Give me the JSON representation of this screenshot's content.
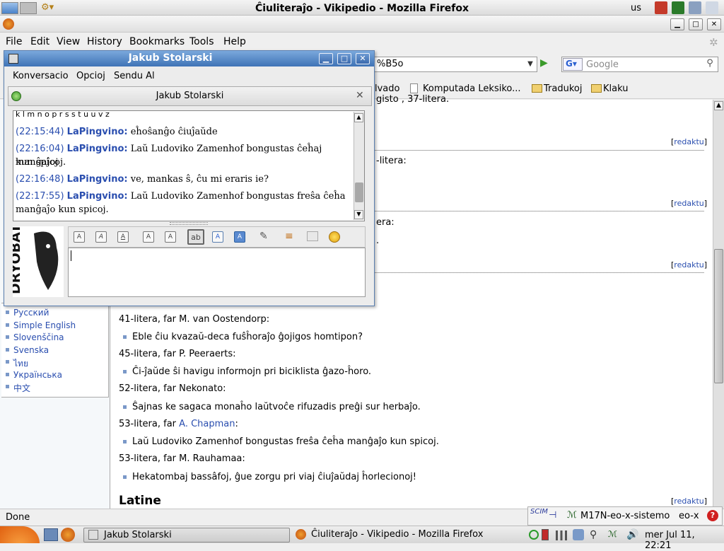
{
  "top_panel": {
    "language": "us"
  },
  "firefox": {
    "title": "Ĉiuliteraĵo - Vikipedio - Mozilla Firefox",
    "menu": [
      "File",
      "Edit",
      "View",
      "History",
      "Bookmarks",
      "Tools",
      "Help"
    ],
    "url_partial": "%B5o",
    "search_placeholder": "Google",
    "bookmarks": [
      "lvado",
      "Komputada Leksiko...",
      "Tradukoj",
      "Klaku"
    ]
  },
  "sidebar_languages": [
    "Русский",
    "Simple English",
    "Slovenščina",
    "Svenska",
    "ไทย",
    "Українська",
    "中文"
  ],
  "article": {
    "top_fragment": "gisto , 37-litera.",
    "frag1": "-litera:",
    "frag2": "era:",
    "frag3": ".",
    "edit_label": "redaktu",
    "entries": [
      {
        "head": "41-litera, far M. van Oostendorp:",
        "text": "Eble ĉiu kvazaŭ-deca fuŝĥoraĵo ĝojigos homtipon?"
      },
      {
        "head": "45-litera, far P. Peeraerts:",
        "text": "Ĉi-ĵaŭde ŝi havigu informojn pri biciklista ĝazo-ĥoro."
      },
      {
        "head": "52-litera, far Nekonato:",
        "text": "Ŝajnas ke sagaca monaĥo laŭtvoĉe rifuzadis preĝi sur herbaĵo."
      },
      {
        "head_prefix": "53-litera, far ",
        "head_link": "A. Chapman",
        "head_suffix": ":",
        "text": "Laŭ Ludoviko Zamenhof bongustas freŝa ĉeĥa manĝaĵo kun spicoj."
      },
      {
        "head": "53-litera, far M. Rauhamaa:",
        "text": "Hekatombaj bassâfoj, ĝue zorgu pri viaj ĉiuĵaŭdaj ĥorlecionoj!"
      }
    ],
    "section_title": "Latine"
  },
  "status": {
    "text": "Done"
  },
  "m17n": {
    "scim": "SCIM",
    "engine": "M17N-eo-x-sistemo",
    "lang": "eo-x"
  },
  "taskbar": {
    "task1": "Jakub Stolarski",
    "task2": "Ĉiuliteraĵo - Vikipedio - Mozilla Firefox",
    "clock": "mer Jul 11, 22:21"
  },
  "chat": {
    "window_title": "Jakub Stolarski",
    "menu": [
      "Konversacio",
      "Opcioj",
      "Sendu Al"
    ],
    "tab_title": "Jakub Stolarski",
    "top_fragment": "k l m n o p r s s t u u v z",
    "messages": [
      {
        "time": "(22:15:44)",
        "nick": "LaPingvino:",
        "text": "eĥoŝanĝo ĉiuĵaŭde"
      },
      {
        "time": "(22:16:04)",
        "nick": "LaPingvino:",
        "text": "Laŭ Ludoviko Zamenhof bongustas ĉeĥaj manĝaĵoj",
        "text2": "kun spicoj."
      },
      {
        "time": "(22:16:48)",
        "nick": "LaPingvino:",
        "text": "ve, mankas ŝ, ĉu mi eraris ie?"
      },
      {
        "time": "(22:17:55)",
        "nick": "LaPingvino:",
        "text": "Laŭ Ludoviko Zamenhof bongustas freŝa ĉeĥa",
        "text2": "manĝaĵo kun spicoj."
      }
    ],
    "buddy_icon_text": "DRYOBATES"
  }
}
